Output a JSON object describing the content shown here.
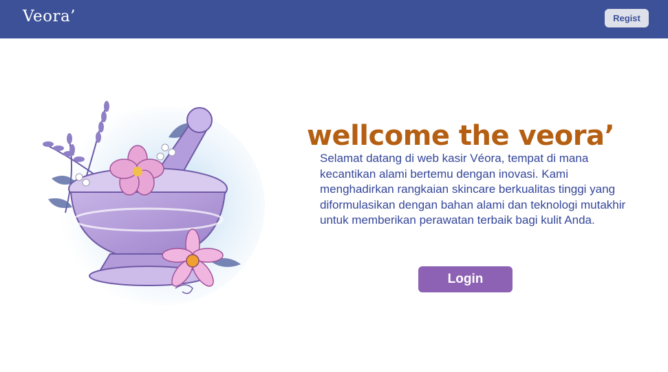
{
  "navbar": {
    "brand": "Veora’",
    "regist_label": "Regist",
    "background": "#3d5198"
  },
  "hero": {
    "headline": "wellcome the veora’",
    "description": "Selamat datang di web kasir Véora, tempat di mana kecantikan alami bertemu dengan inovasi. Kami menghadirkan rangkaian skincare berkualitas tinggi yang diformulasikan dengan bahan alami dan teknologi mutakhir untuk memberikan perawatan terbaik bagi kulit Anda.",
    "login_label": "Login",
    "illustration_icon": "mortar-and-pestle-with-flowers",
    "headline_color": "#b45f12",
    "text_color": "#34469a",
    "button_color": "#8d61b3"
  }
}
